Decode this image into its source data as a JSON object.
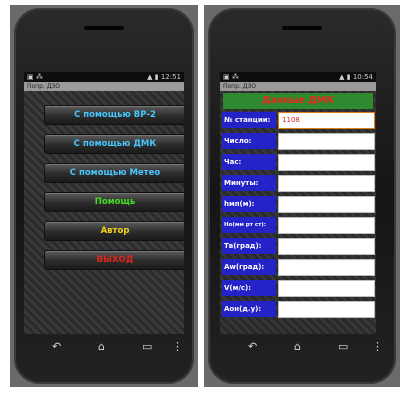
{
  "left": {
    "status_left": "▣ ⁂",
    "status_right": "▲ ▮ 12:51",
    "app_title": "Попр. ДЗО",
    "buttons": [
      {
        "label": "С помощью ВР-2",
        "color": "#46c6ff"
      },
      {
        "label": "С помощью ДМК",
        "color": "#46c6ff"
      },
      {
        "label": "С помощью Метео",
        "color": "#46c6ff"
      },
      {
        "label": "Помощь",
        "color": "#44dd22"
      },
      {
        "label": "Автор",
        "color": "#f2d21c"
      },
      {
        "label": "ВЫХОД",
        "color": "#e0241b"
      }
    ]
  },
  "right": {
    "status_left": "▣ ⁂",
    "status_right": "▲ ▮ 10:54",
    "app_title": "Попр. ДЗО",
    "header": "Данные ДМК",
    "fields": [
      {
        "label": "№ станции:",
        "value": "1108"
      },
      {
        "label": "Число:",
        "value": ""
      },
      {
        "label": "Час:",
        "value": ""
      },
      {
        "label": "Минуты:",
        "value": ""
      },
      {
        "label": "hмп(м):",
        "value": ""
      },
      {
        "label": "Но(мм рт ст):",
        "value": ""
      },
      {
        "label": "Тв(град):",
        "value": ""
      },
      {
        "label": "Аw(град):",
        "value": ""
      },
      {
        "label": "V(м/с):",
        "value": ""
      },
      {
        "label": "Аон(д.у):",
        "value": ""
      }
    ]
  },
  "nav": {
    "back": "↶",
    "home": "⌂",
    "recent": "▭",
    "menu": "⋮"
  }
}
